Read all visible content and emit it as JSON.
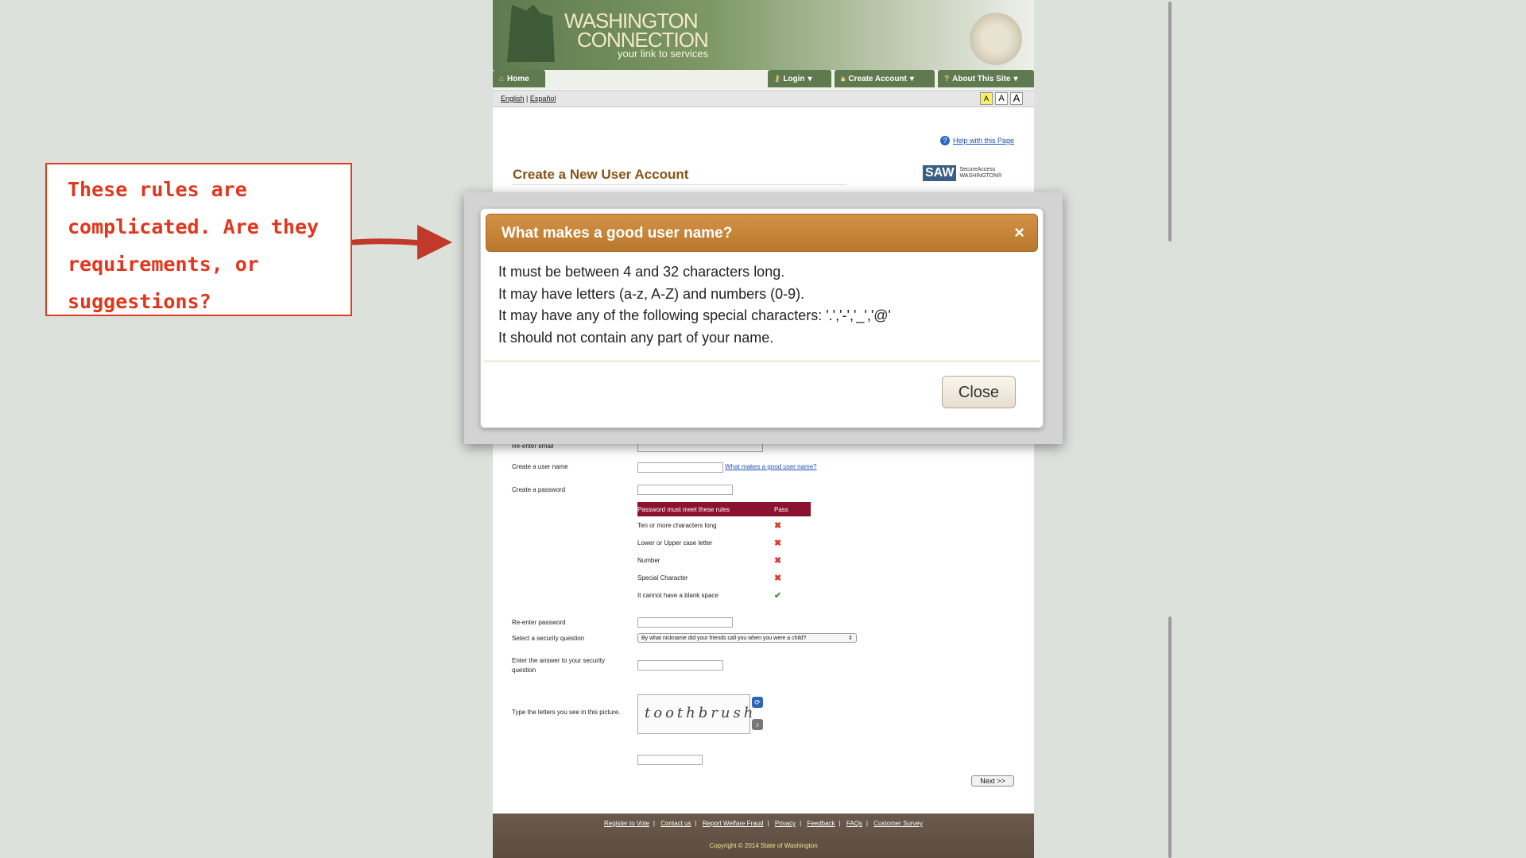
{
  "header": {
    "logo_title_line1": "WASHINGTON",
    "logo_title_line2": "CONNECTION",
    "tagline": "your link to services"
  },
  "nav": {
    "home": "Home",
    "login": "Login",
    "create_account": "Create Account",
    "about": "About This Site"
  },
  "lang": {
    "english": "English",
    "sep": "|",
    "espanol": "Español"
  },
  "font_size_controls": [
    "A",
    "A",
    "A"
  ],
  "help_link": "Help with this Page",
  "page_title": "Create a New User Account",
  "saw": {
    "badge": "SAW",
    "line1": "SecureAccess",
    "line2": "WASHINGTON®"
  },
  "form": {
    "reenter_email_label": "Re-enter email",
    "username_label": "Create a user name",
    "username_help_link": "What makes a good user name?",
    "password_label": "Create a password",
    "pw_table_header": "Password must meet these rules",
    "pw_table_pass": "Pass",
    "pw_rules": [
      {
        "rule": "Ten or more characters long",
        "mark": "✖"
      },
      {
        "rule": "Lower or Upper case letter",
        "mark": "✖"
      },
      {
        "rule": "Number",
        "mark": "✖"
      },
      {
        "rule": "Special Character",
        "mark": "✖"
      },
      {
        "rule": "It cannot have a blank space",
        "mark": "✔"
      }
    ],
    "reenter_password_label": "Re-enter password",
    "security_question_label": "Select a security question",
    "security_question_value": "By what nickname did your friends call you when you were a child?",
    "security_answer_label": "Enter the answer to your security question",
    "captcha_label": "Type the letters you see in this picture.",
    "captcha_text": "toothbrush",
    "next_button": "Next >>"
  },
  "footer": {
    "links": [
      "Register to Vote",
      "Contact us",
      "Report Welfare Fraud",
      "Privacy",
      "Feedback",
      "FAQs",
      "Customer Survey"
    ],
    "copyright": "Copyright © 2014 State of Washington"
  },
  "dialog": {
    "title": "What makes a good user name?",
    "close_x": "×",
    "lines": [
      "It must be between 4 and 32 characters long.",
      "It may have letters (a-z, A-Z) and numbers (0-9).",
      "It may have any of the following special characters: '.','-','_','@'",
      "It should not contain any part of your name."
    ],
    "close_button": "Close"
  },
  "annotation": {
    "text": "These rules are complicated. Are they requirements, or suggestions?"
  },
  "colors": {
    "header_green": "#5f7a4f",
    "title_brown": "#8a5216",
    "dialog_header": "#c6863a",
    "pw_header": "#8c1330",
    "annotation_red": "#e2361c"
  }
}
